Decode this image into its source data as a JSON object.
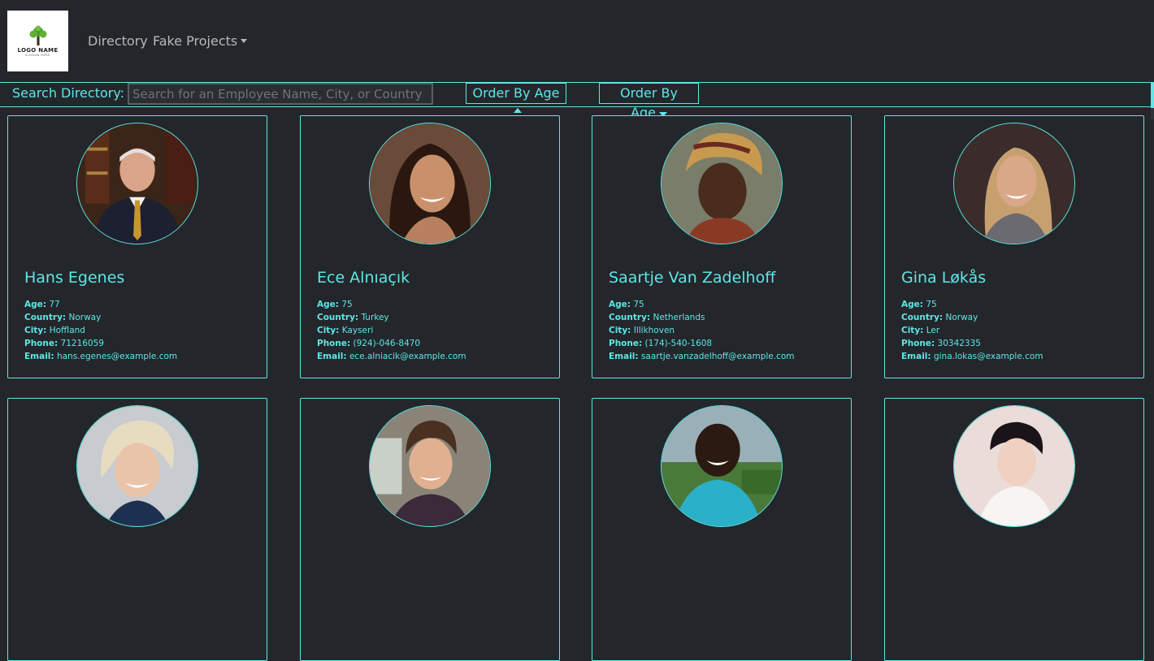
{
  "nav": {
    "logo_name": "LOGO NAME",
    "logo_slogan": "SLOGAN HERE",
    "directory": "Directory",
    "fake_projects": "Fake Projects"
  },
  "search": {
    "label": "Search Directory:",
    "placeholder": "Search for an Employee Name, City, or Country",
    "value": "",
    "order_asc": "Order By Age",
    "order_desc": "Order By Age"
  },
  "field_labels": {
    "age": "Age:",
    "country": "Country:",
    "city": "City:",
    "phone": "Phone:",
    "email": "Email:"
  },
  "employees": [
    {
      "name": "Hans Egenes",
      "age": "77",
      "country": "Norway",
      "city": "Hoffland",
      "phone": "71216059",
      "email": "hans.egenes@example.com"
    },
    {
      "name": "Ece Alnıaçık",
      "age": "75",
      "country": "Turkey",
      "city": "Kayseri",
      "phone": "(924)-046-8470",
      "email": "ece.alniacik@example.com"
    },
    {
      "name": "Saartje Van Zadelhoff",
      "age": "75",
      "country": "Netherlands",
      "city": "Illikhoven",
      "phone": "(174)-540-1608",
      "email": "saartje.vanzadelhoff@example.com"
    },
    {
      "name": "Gina Løkås",
      "age": "75",
      "country": "Norway",
      "city": "Ler",
      "phone": "30342335",
      "email": "gina.lokas@example.com"
    }
  ],
  "colors": {
    "background": "#23272b",
    "accent": "#5fe6e6",
    "nav_text": "#b8b8b8"
  }
}
